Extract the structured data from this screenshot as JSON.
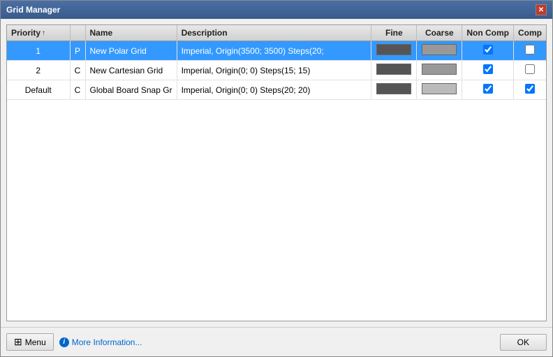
{
  "window": {
    "title": "Grid Manager"
  },
  "titlebar": {
    "close_label": "✕"
  },
  "table": {
    "columns": [
      {
        "id": "priority",
        "label": "Priority"
      },
      {
        "id": "type",
        "label": ""
      },
      {
        "id": "name",
        "label": "Name"
      },
      {
        "id": "description",
        "label": "Description"
      },
      {
        "id": "fine",
        "label": "Fine"
      },
      {
        "id": "coarse",
        "label": "Coarse"
      },
      {
        "id": "noncomp",
        "label": "Non Comp"
      },
      {
        "id": "comp",
        "label": "Comp"
      }
    ],
    "rows": [
      {
        "priority": "1",
        "type": "P",
        "name": "New Polar Grid",
        "description": "Imperial, Origin(3500; 3500) Steps(20;",
        "fine_swatch": "dark",
        "coarse_swatch": "mid",
        "noncomp": true,
        "comp": false,
        "selected": true
      },
      {
        "priority": "2",
        "type": "C",
        "name": "New Cartesian Grid",
        "description": "Imperial, Origin(0; 0) Steps(15; 15)",
        "fine_swatch": "dark",
        "coarse_swatch": "mid",
        "noncomp": true,
        "comp": false,
        "selected": false
      },
      {
        "priority": "Default",
        "type": "C",
        "name": "Global Board Snap Gr",
        "description": "Imperial, Origin(0; 0) Steps(20; 20)",
        "fine_swatch": "dark",
        "coarse_swatch": "light",
        "noncomp": true,
        "comp": true,
        "selected": false
      }
    ]
  },
  "footer": {
    "menu_label": "Menu",
    "info_label": "More Information...",
    "ok_label": "OK"
  }
}
